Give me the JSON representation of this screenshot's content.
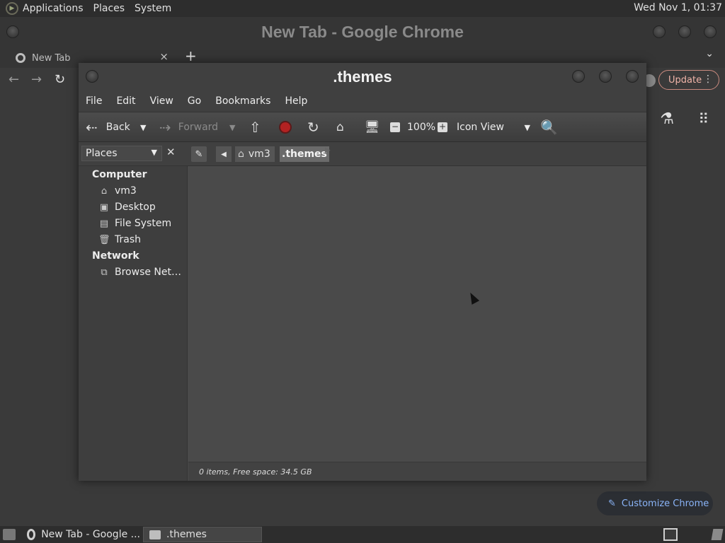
{
  "top_panel": {
    "menus": [
      "Applications",
      "Places",
      "System"
    ],
    "clock": "Wed Nov 1, 01:37"
  },
  "chrome": {
    "window_title": "New Tab - Google Chrome",
    "tab_label": "New Tab",
    "close_tab": "×",
    "new_tab": "+",
    "tab_search": "⌄",
    "update_label": "Update",
    "customize_label": "Customize Chrome"
  },
  "file_manager": {
    "window_title": ".themes",
    "menus": [
      "File",
      "Edit",
      "View",
      "Go",
      "Bookmarks",
      "Help"
    ],
    "toolbar": {
      "back": "Back",
      "forward": "Forward",
      "zoom": "100%",
      "view_mode": "Icon View"
    },
    "places_label": "Places",
    "breadcrumb": {
      "parent": "vm3",
      "current": ".themes"
    },
    "sidebar": {
      "computer_header": "Computer",
      "computer_items": [
        "vm3",
        "Desktop",
        "File System",
        "Trash"
      ],
      "network_header": "Network",
      "network_items": [
        "Browse Net…"
      ]
    },
    "status": "0 items, Free space: 34.5 GB"
  },
  "taskbar": {
    "tasks": [
      "New Tab - Google ...",
      ".themes"
    ]
  }
}
